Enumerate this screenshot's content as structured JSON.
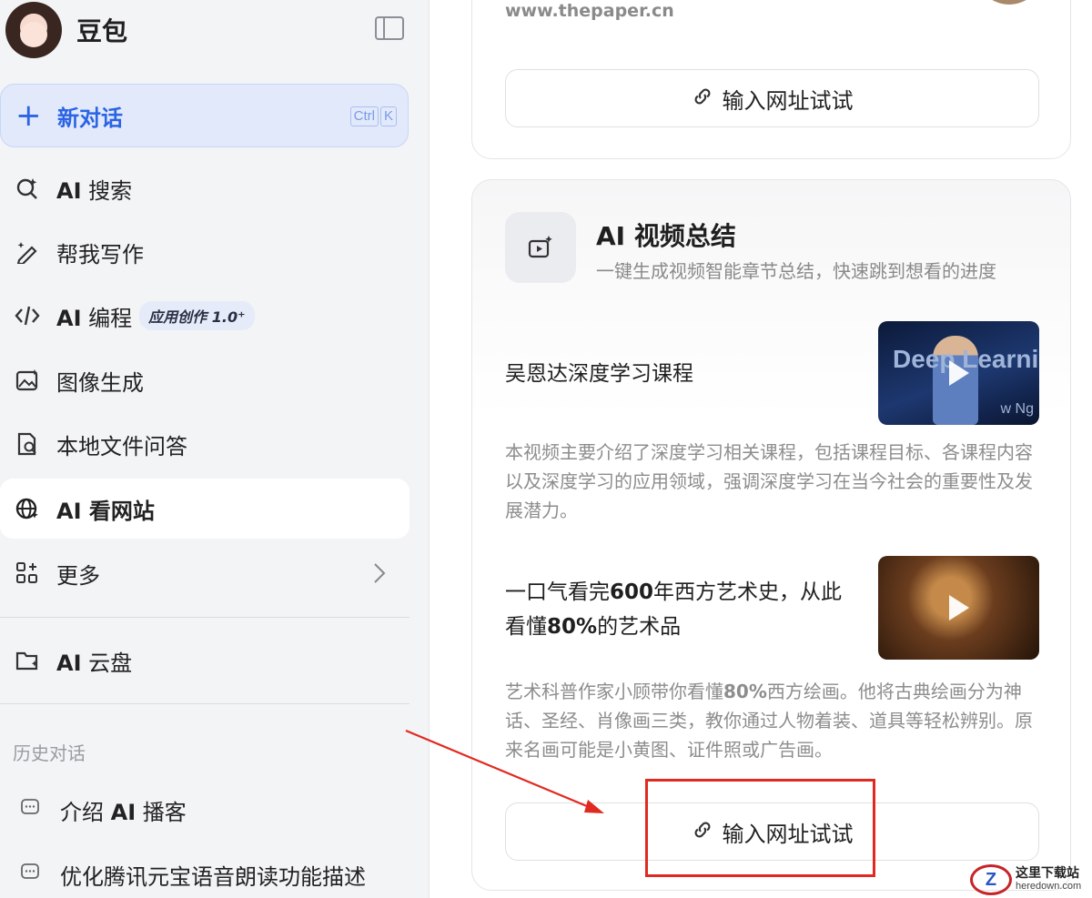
{
  "sidebar": {
    "brand_name": "豆包",
    "new_chat": {
      "label": "新对话",
      "shortcut_keys": [
        "Ctrl",
        "K"
      ]
    },
    "nav_items": [
      {
        "icon": "ai-search-icon",
        "label_prefix": "AI",
        "label": " 搜索"
      },
      {
        "icon": "pen-sparkle-icon",
        "label_prefix": "",
        "label": "帮我写作"
      },
      {
        "icon": "code-icon",
        "label_prefix": "AI",
        "label": " 编程",
        "badge": "应用创作 1.0⁺"
      },
      {
        "icon": "image-gen-icon",
        "label_prefix": "",
        "label": "图像生成"
      },
      {
        "icon": "file-qa-icon",
        "label_prefix": "",
        "label": "本地文件问答"
      },
      {
        "icon": "globe-sparkle-icon",
        "label_prefix": "AI",
        "label": " 看网站",
        "active": true
      },
      {
        "icon": "apps-grid-icon",
        "label_prefix": "",
        "label": "更多"
      }
    ],
    "cloud": {
      "icon": "cloud-folder-icon",
      "label_prefix": "AI",
      "label": " 云盘"
    },
    "history_title": "历史对话",
    "history": [
      {
        "label_prefix": "介绍 ",
        "label_bold": "AI",
        "label_suffix": " 播客"
      },
      {
        "label_prefix": "优化腾讯元宝语音朗读功能描述",
        "label_bold": "",
        "label_suffix": ""
      }
    ]
  },
  "main": {
    "top_card": {
      "source": "www.thepaper.cn",
      "try_button": "输入网址试试"
    },
    "video_card": {
      "title": "AI 视频总结",
      "subtitle": "一键生成视频智能章节总结，快速跳到想看的进度",
      "videos": [
        {
          "title_parts": [
            {
              "t": "吴恩达深度学习课程",
              "b": false
            }
          ],
          "thumb_text": "Deep Learni",
          "thumb_text2": "w Ng",
          "desc": "本视频主要介绍了深度学习相关课程，包括课程目标、各课程内容以及深度学习的应用领域，强调深度学习在当今社会的重要性及发展潜力。"
        },
        {
          "title_parts": [
            {
              "t": "一口气看完",
              "b": false
            },
            {
              "t": "600",
              "b": true
            },
            {
              "t": "年西方艺术史，从此看懂",
              "b": false
            },
            {
              "t": "80%",
              "b": true
            },
            {
              "t": "的艺术品",
              "b": false
            }
          ],
          "desc_parts": [
            {
              "t": "艺术科普作家小顾带你看懂",
              "b": false
            },
            {
              "t": "80%",
              "b": true
            },
            {
              "t": "西方绘画。他将古典绘画分为神话、圣经、肖像画三类，教你通过人物着装、道具等轻松辨别。原来名画可能是小黄图、证件照或广告画。",
              "b": false
            }
          ]
        }
      ],
      "try_button": "输入网址试试"
    }
  },
  "watermark": {
    "line1": "这里下载站",
    "line2": "heredown.com",
    "logo_letter": "Z"
  },
  "colors": {
    "accent": "#2b64e4",
    "annotation": "#e02a21",
    "sidebar_bg": "#f3f4f6"
  }
}
